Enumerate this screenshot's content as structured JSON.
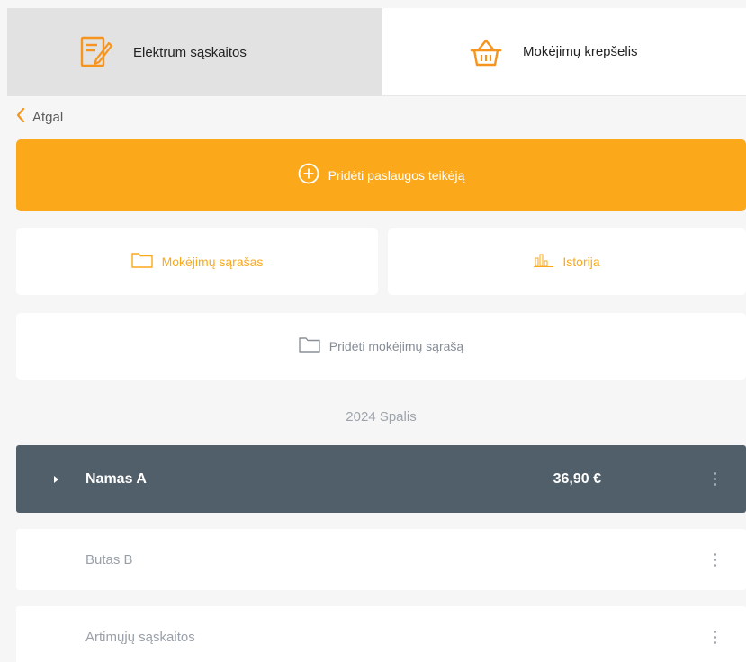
{
  "tabs": [
    {
      "label": "Elektrum sąskaitos",
      "icon": "invoice-edit-icon",
      "active": true
    },
    {
      "label": "Mokėjimų krepšelis",
      "icon": "basket-icon",
      "active": false
    }
  ],
  "back": {
    "label": "Atgal",
    "icon": "chevron-left-icon"
  },
  "add_provider": {
    "label": "Pridėti paslaugos teikėją",
    "icon": "plus-circle-icon"
  },
  "actions": {
    "payment_list": {
      "label": "Mokėjimų sąrašas",
      "icon": "folder-icon"
    },
    "history": {
      "label": "Istorija",
      "icon": "bar-chart-icon"
    },
    "add_payment_list": {
      "label": "Pridėti mokėjimų sąrašą",
      "icon": "folder-icon"
    }
  },
  "period": "2024 Spalis",
  "rows": [
    {
      "name": "Namas A",
      "amount": "36,90 €",
      "expanded": true
    },
    {
      "name": "Butas B",
      "amount": ""
    },
    {
      "name": "Artimųjų sąskaitos",
      "amount": ""
    }
  ],
  "colors": {
    "accent": "#fba91b",
    "row_active": "#515f6b",
    "background": "#f6f6f6"
  }
}
